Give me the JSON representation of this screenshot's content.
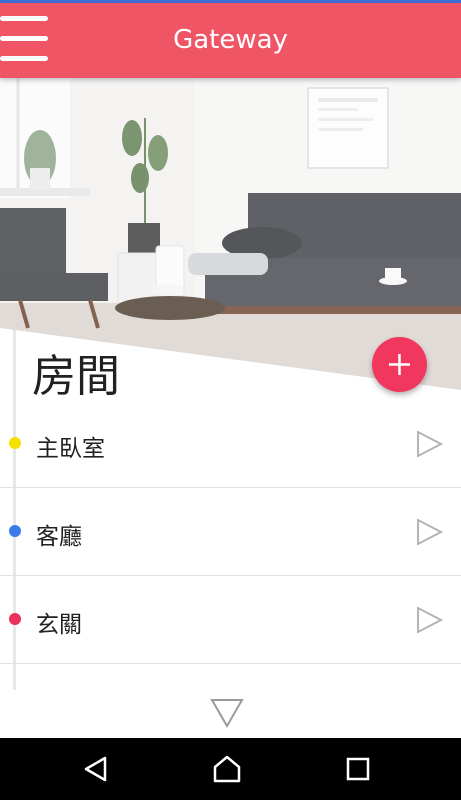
{
  "app_bar": {
    "title": "Gateway",
    "menu_icon": "hamburger-menu-icon",
    "color": "#f05566"
  },
  "hero": {
    "description_icon": "living-room-photo"
  },
  "section": {
    "title": "房間"
  },
  "fab": {
    "icon": "plus-icon",
    "color": "#f2375e"
  },
  "rooms": [
    {
      "name": "主臥室",
      "dot_color": "#f5e100",
      "action_icon": "play-icon"
    },
    {
      "name": "客廳",
      "dot_color": "#3d7aea",
      "action_icon": "play-icon"
    },
    {
      "name": "玄關",
      "dot_color": "#ec2f5c",
      "action_icon": "play-icon"
    }
  ],
  "more_icon": "expand-down-icon",
  "nav_bar": {
    "back_icon": "back-icon",
    "home_icon": "home-icon",
    "recents_icon": "recents-icon"
  }
}
